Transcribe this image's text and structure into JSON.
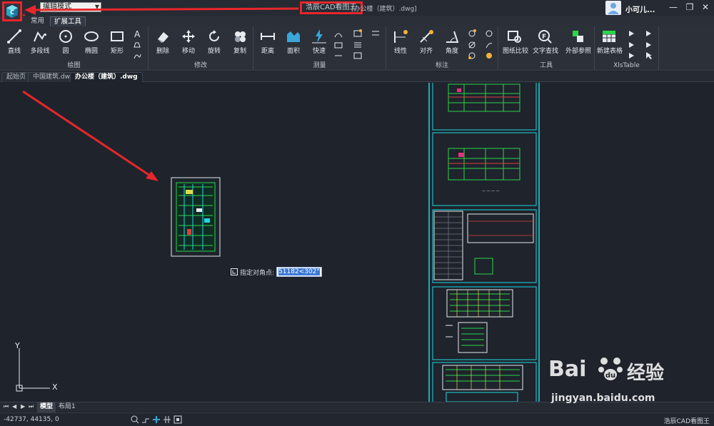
{
  "titlebar": {
    "mode": "编辑模式",
    "app_title": "浩辰CAD看图王",
    "file_title": "[办公楼（建筑）.dwg]",
    "user_name": "小可儿...",
    "minimize": "—",
    "restore": "❐",
    "close": "✕"
  },
  "ribbon_tabs": [
    "常用",
    "扩展工具"
  ],
  "ribbon": {
    "draw": {
      "label": "绘图",
      "tools": [
        "直线",
        "多段线",
        "圆",
        "椭圆",
        "矩形"
      ]
    },
    "modify": {
      "label": "修改",
      "tools": [
        "删除",
        "移动",
        "旋转",
        "复制"
      ]
    },
    "measure": {
      "label": "测量",
      "tools": [
        "距离",
        "面积",
        "快速"
      ]
    },
    "annotate": {
      "label": "标注",
      "tools": [
        "线性",
        "对齐",
        "角度"
      ]
    },
    "tools": {
      "label": "工具",
      "tools": [
        "图纸比较",
        "文字查找",
        "外部参照"
      ]
    },
    "xlstable": {
      "label": "XlsTable",
      "tools": [
        "新建表格"
      ]
    }
  },
  "doc_tabs": [
    "起始页",
    "中国建筑.dwg",
    "办公楼（建筑）.dwg"
  ],
  "command": {
    "label": "指定对角点:",
    "value": "51182<302°"
  },
  "layout_tabs": [
    "模型",
    "布局1"
  ],
  "status": {
    "coords": "-42737, 44135, 0",
    "brand": "浩辰CAD看图王"
  },
  "watermark": {
    "logo": "Bai",
    "logo2": "du",
    "cn": "经验",
    "url": "jingyan.baidu.com"
  },
  "axis": {
    "x": "X",
    "y": "Y"
  },
  "colors": {
    "accent": "#e8262b",
    "canvas": "#1e232c",
    "drawing_cyan": "#1fd8e0",
    "drawing_green": "#2bd64a"
  }
}
